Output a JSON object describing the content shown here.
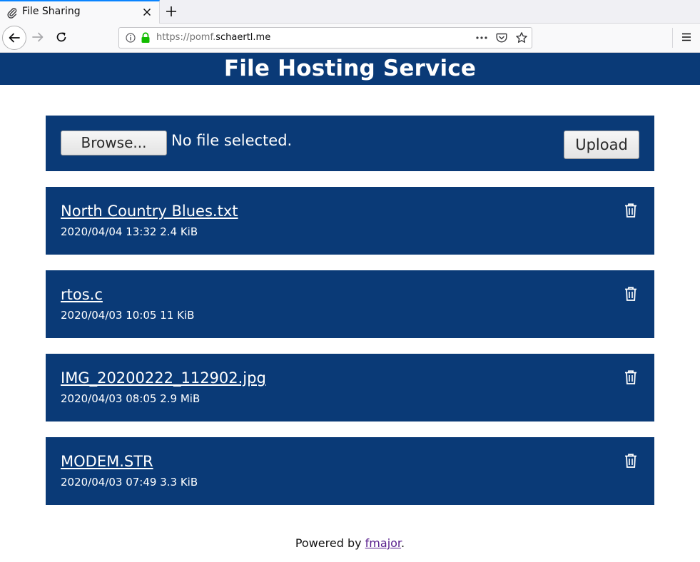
{
  "browser": {
    "tab_title": "File Sharing",
    "url_prefix": "https://pomf.",
    "url_domain": "schaertl.me"
  },
  "page": {
    "title": "File Hosting Service",
    "browse_label": "Browse...",
    "file_status": "No file selected.",
    "upload_label": "Upload"
  },
  "files": [
    {
      "name": "North Country Blues.txt",
      "meta": "2020/04/04 13:32 2.4 KiB"
    },
    {
      "name": "rtos.c",
      "meta": "2020/04/03 10:05 11 KiB"
    },
    {
      "name": "IMG_20200222_112902.jpg",
      "meta": "2020/04/03 08:05 2.9 MiB"
    },
    {
      "name": "MODEM.STR",
      "meta": "2020/04/03 07:49 3.3 KiB"
    }
  ],
  "footer": {
    "prefix": "Powered by ",
    "link_text": "fmajor",
    "suffix": "."
  },
  "colors": {
    "brand": "#0a3a77",
    "link_visited": "#551a8b",
    "tab_accent": "#0a84ff"
  }
}
